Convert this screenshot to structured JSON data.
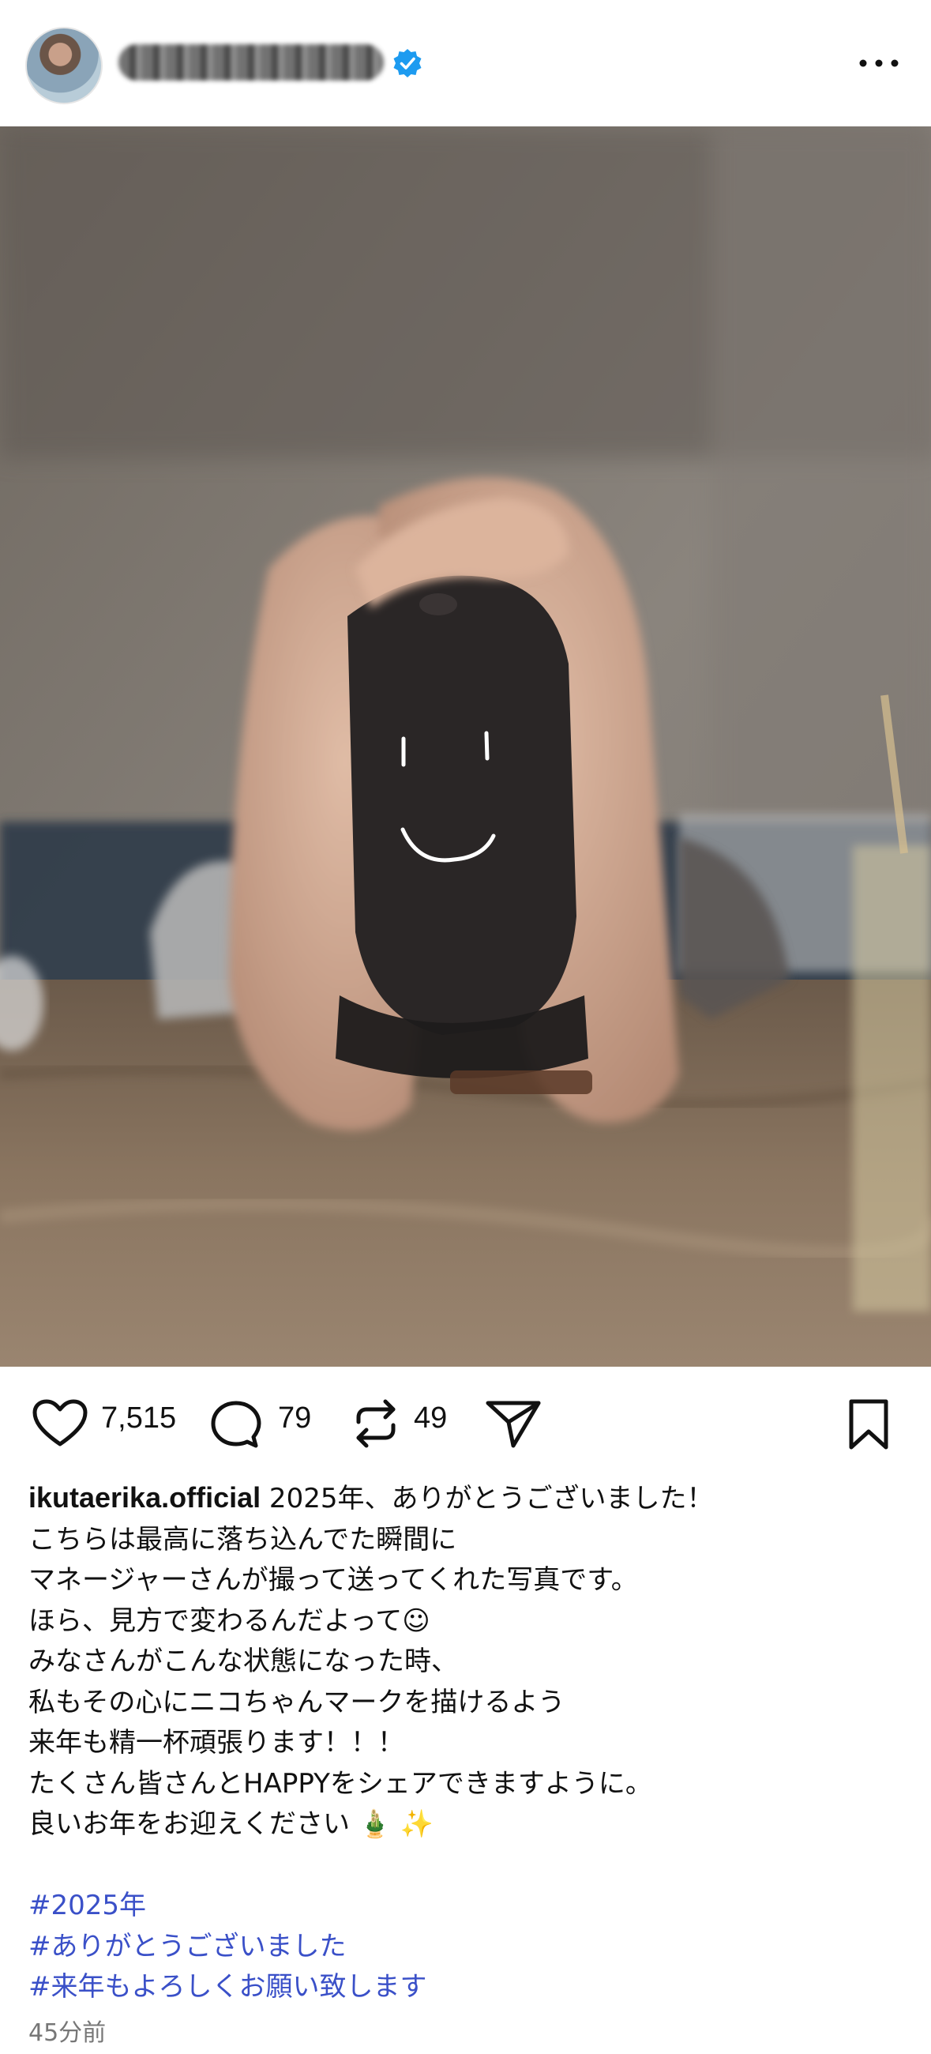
{
  "post": {
    "verified": true,
    "icons": {
      "more": "more-horizontal-icon",
      "verified": "verified-badge-icon"
    }
  },
  "image": {
    "description_icon": "photo-image"
  },
  "actions": {
    "likes": "7,515",
    "comments": "79",
    "reposts": "49",
    "icons": [
      "heart-icon",
      "comment-icon",
      "repost-icon",
      "share-icon",
      "bookmark-icon"
    ]
  },
  "caption": {
    "username": "ikutaerika.official",
    "first_line": " 2025年、ありがとうございました！",
    "lines": [
      "こちらは最高に落ち込んでた瞬間に",
      "マネージャーさんが撮って送ってくれた写真です。",
      "ほら、見方で変わるんだよって☺",
      "みなさんがこんな状態になった時、",
      "私もその心にニコちゃんマークを描けるよう",
      "来年も精一杯頑張ります！！！",
      "たくさん皆さんとHAPPYをシェアできますように。",
      "良いお年をお迎えください 🎍 ✨"
    ],
    "hashtags": [
      "#2025年",
      "#ありがとうございました",
      "#来年もよろしくお願い致します"
    ]
  },
  "timestamp": "45分前",
  "colors": {
    "hashtag": "#3a50c8",
    "verified": "#1d9bf0",
    "timestamp": "#777777"
  }
}
